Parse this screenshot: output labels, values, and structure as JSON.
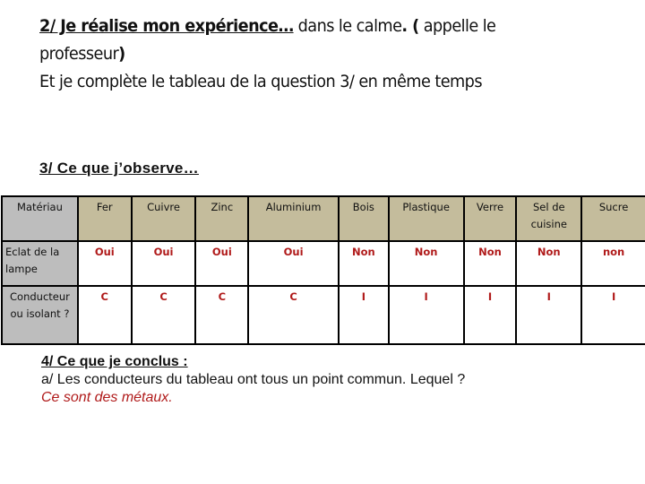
{
  "intro": {
    "step_heading": "2/ Je réalise mon expérience…",
    "step_text_1": " dans le calme",
    "step_text_2": ". (",
    "step_text_3": " appelle le professeur",
    "step_text_4": ")",
    "line2": "Et je complète le tableau de la question  3/ en même temps"
  },
  "observation": {
    "title": "3/ Ce que j’observe…",
    "table": {
      "header_label": "Matériau",
      "columns": [
        "Fer",
        "Cuivre",
        "Zinc",
        "Aluminium",
        "Bois",
        "Plastique",
        "Verre",
        "Sel de cuisine",
        "Sucre"
      ],
      "rows": [
        {
          "label": "Eclat de la lampe",
          "values": [
            "Oui",
            "Oui",
            "Oui",
            "Oui",
            "Non",
            "Non",
            "Non",
            "Non",
            "non"
          ]
        },
        {
          "label": "Conducteur ou isolant ?",
          "values": [
            "C",
            "C",
            "C",
            "C",
            "I",
            "I",
            "I",
            "I",
            "I"
          ]
        }
      ]
    }
  },
  "conclusion": {
    "title": "4/ Ce que je conclus :",
    "question": "a/ Les conducteurs du tableau ont tous un point commun. Lequel ?",
    "answer": "Ce sont des métaux."
  },
  "colors": {
    "header_fill": "#c4bc9c",
    "label_fill": "#bdbdbd",
    "answer_red": "#b01a1a"
  }
}
